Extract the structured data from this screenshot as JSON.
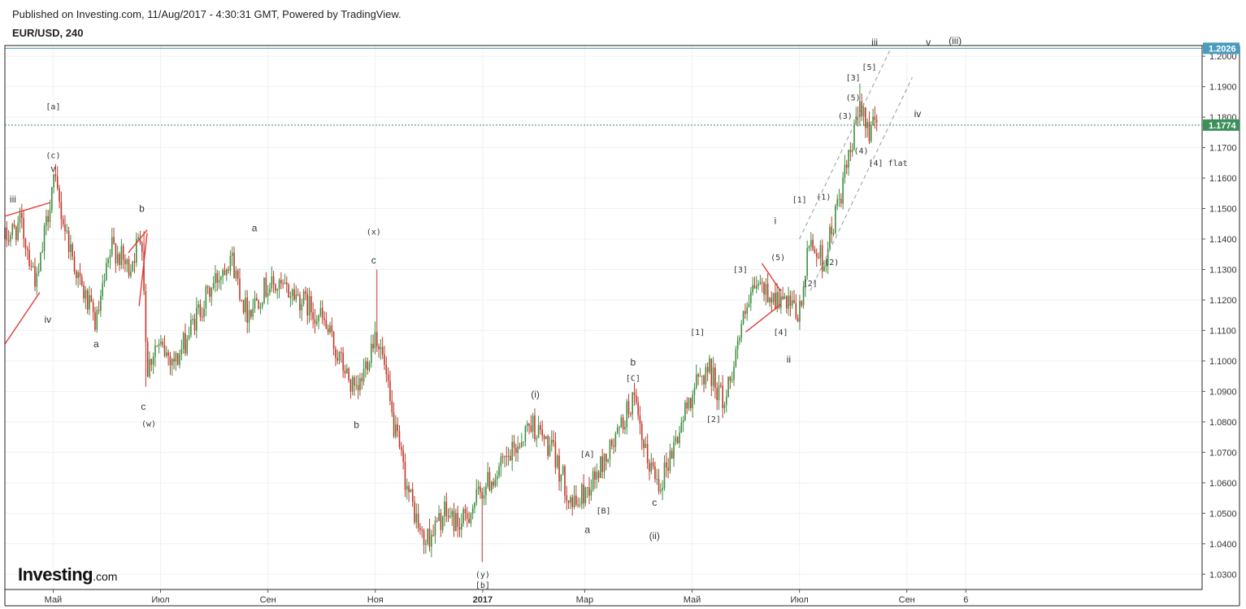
{
  "header": {
    "published": "Published on Investing.com, 11/Aug/2017 - 4:30:31 GMT, Powered by TradingView.",
    "symbol": "EUR/USD, 240"
  },
  "logo": {
    "name": "Investing",
    "suffix": ".com"
  },
  "colors": {
    "up": "#3f8f3f",
    "down": "#c0392b",
    "grid": "#eef0f3",
    "frame": "#222222",
    "hline_top": "#4a9cbf",
    "current_line": "#2e7d4f",
    "current_tag": "#3a8f5a",
    "top_tag": "#4a9cbf",
    "trend_red": "#e53935",
    "channel": "#999999"
  },
  "chart_data": {
    "type": "candlestick",
    "symbol": "EUR/USD",
    "interval": "240",
    "ylim": [
      1.025,
      1.2035
    ],
    "grid": true,
    "y_ticks": [
      1.03,
      1.04,
      1.05,
      1.06,
      1.07,
      1.08,
      1.09,
      1.1,
      1.11,
      1.12,
      1.13,
      1.14,
      1.15,
      1.16,
      1.17,
      1.18,
      1.19,
      1.2
    ],
    "y_tick_labels": [
      "1.0300",
      "1.0400",
      "1.0500",
      "1.0600",
      "1.0700",
      "1.0800",
      "1.0900",
      "1.1000",
      "1.1100",
      "1.1200",
      "1.1300",
      "1.1400",
      "1.1500",
      "1.1600",
      "1.1700",
      "1.1800",
      "1.1900",
      "1.2000"
    ],
    "x_ticks": [
      {
        "label": "Май",
        "t": 0.0,
        "bold": false
      },
      {
        "label": "Июл",
        "t": 2.0,
        "bold": false
      },
      {
        "label": "Сен",
        "t": 4.0,
        "bold": false
      },
      {
        "label": "Ноя",
        "t": 6.0,
        "bold": false
      },
      {
        "label": "2017",
        "t": 8.0,
        "bold": true
      },
      {
        "label": "Мар",
        "t": 9.9,
        "bold": false
      },
      {
        "label": "Май",
        "t": 11.9,
        "bold": false
      },
      {
        "label": "Июл",
        "t": 13.9,
        "bold": false
      },
      {
        "label": "Сен",
        "t": 15.9,
        "bold": false
      },
      {
        "label": "6",
        "t": 17.0,
        "bold": false
      }
    ],
    "x_range": [
      -0.9,
      21.4
    ],
    "horizontal_levels": [
      {
        "value": 1.2026,
        "label": "1.2026",
        "style": "solid",
        "color_key": "top_tag"
      },
      {
        "value": 1.1774,
        "label": "1.1774",
        "style": "dotted",
        "color_key": "current_tag"
      }
    ],
    "price_path": [
      [
        -0.9,
        1.14
      ],
      [
        -0.6,
        1.145
      ],
      [
        -0.3,
        1.125
      ],
      [
        0.0,
        1.16
      ],
      [
        0.2,
        1.145
      ],
      [
        0.5,
        1.125
      ],
      [
        0.8,
        1.112
      ],
      [
        1.1,
        1.138
      ],
      [
        1.4,
        1.13
      ],
      [
        1.65,
        1.142
      ],
      [
        1.75,
        1.097
      ],
      [
        1.9,
        1.105
      ],
      [
        2.3,
        1.1
      ],
      [
        2.7,
        1.116
      ],
      [
        3.3,
        1.135
      ],
      [
        3.6,
        1.116
      ],
      [
        4.0,
        1.125
      ],
      [
        4.5,
        1.122
      ],
      [
        5.0,
        1.114
      ],
      [
        5.3,
        1.102
      ],
      [
        5.65,
        1.088
      ],
      [
        6.0,
        1.11
      ],
      [
        6.15,
        1.1
      ],
      [
        6.3,
        1.082
      ],
      [
        6.6,
        1.058
      ],
      [
        6.9,
        1.04
      ],
      [
        7.3,
        1.05
      ],
      [
        7.6,
        1.046
      ],
      [
        8.0,
        1.058
      ],
      [
        8.5,
        1.068
      ],
      [
        8.9,
        1.08
      ],
      [
        9.3,
        1.07
      ],
      [
        9.7,
        1.052
      ],
      [
        10.1,
        1.062
      ],
      [
        10.5,
        1.075
      ],
      [
        10.8,
        1.088
      ],
      [
        11.0,
        1.07
      ],
      [
        11.3,
        1.06
      ],
      [
        11.6,
        1.074
      ],
      [
        11.9,
        1.09
      ],
      [
        12.2,
        1.098
      ],
      [
        12.5,
        1.086
      ],
      [
        12.8,
        1.11
      ],
      [
        13.1,
        1.125
      ],
      [
        13.5,
        1.12
      ],
      [
        13.9,
        1.115
      ],
      [
        14.1,
        1.14
      ],
      [
        14.35,
        1.132
      ],
      [
        14.6,
        1.15
      ],
      [
        14.85,
        1.168
      ],
      [
        15.05,
        1.185
      ],
      [
        15.2,
        1.176
      ],
      [
        15.35,
        1.177
      ]
    ],
    "path_spikes": [
      {
        "t": 0.02,
        "high": 1.1615
      },
      {
        "t": 1.68,
        "high": 1.1425
      },
      {
        "t": 1.72,
        "low": 1.0915
      },
      {
        "t": 6.02,
        "high": 1.13
      },
      {
        "t": 7.98,
        "low": 1.034
      },
      {
        "t": 15.02,
        "high": 1.191
      }
    ],
    "wave_labels": [
      {
        "text": "[a]",
        "t": 0.0,
        "y": 1.1825,
        "size": "small"
      },
      {
        "text": "(c)",
        "t": 0.0,
        "y": 1.1665,
        "size": "small"
      },
      {
        "text": "v",
        "t": 0.0,
        "y": 1.162,
        "size": "normal"
      },
      {
        "text": "iii",
        "t": -0.75,
        "y": 1.152,
        "size": "normal"
      },
      {
        "text": "iv",
        "t": -0.1,
        "y": 1.1125,
        "size": "normal"
      },
      {
        "text": "a",
        "t": 0.8,
        "y": 1.1045,
        "size": "normal"
      },
      {
        "text": "b",
        "t": 1.65,
        "y": 1.149,
        "size": "normal"
      },
      {
        "text": "c",
        "t": 1.68,
        "y": 1.084,
        "size": "normal"
      },
      {
        "text": "(w)",
        "t": 1.78,
        "y": 1.0785,
        "size": "small"
      },
      {
        "text": "a",
        "t": 3.75,
        "y": 1.1425,
        "size": "normal"
      },
      {
        "text": "(x)",
        "t": 5.97,
        "y": 1.1415,
        "size": "small"
      },
      {
        "text": "c",
        "t": 5.97,
        "y": 1.132,
        "size": "normal"
      },
      {
        "text": "b",
        "t": 5.65,
        "y": 1.078,
        "size": "normal"
      },
      {
        "text": "(y)",
        "t": 8.0,
        "y": 1.029,
        "size": "small"
      },
      {
        "text": "[b]",
        "t": 8.0,
        "y": 1.0255,
        "size": "small"
      },
      {
        "text": "(i)",
        "t": 8.98,
        "y": 1.088,
        "size": "normal"
      },
      {
        "text": "[A]",
        "t": 9.95,
        "y": 1.0685,
        "size": "small"
      },
      {
        "text": "[B]",
        "t": 10.25,
        "y": 1.05,
        "size": "small"
      },
      {
        "text": "a",
        "t": 9.95,
        "y": 1.0435,
        "size": "normal"
      },
      {
        "text": "b",
        "t": 10.8,
        "y": 1.0985,
        "size": "normal"
      },
      {
        "text": "[C]",
        "t": 10.8,
        "y": 1.0935,
        "size": "small"
      },
      {
        "text": "c",
        "t": 11.2,
        "y": 1.0525,
        "size": "normal"
      },
      {
        "text": "(ii)",
        "t": 11.2,
        "y": 1.0415,
        "size": "normal"
      },
      {
        "text": "[1]",
        "t": 12.0,
        "y": 1.1085,
        "size": "small"
      },
      {
        "text": "[2]",
        "t": 12.3,
        "y": 1.08,
        "size": "small"
      },
      {
        "text": "[3]",
        "t": 12.8,
        "y": 1.129,
        "size": "small"
      },
      {
        "text": "i",
        "t": 13.45,
        "y": 1.145,
        "size": "normal"
      },
      {
        "text": "(5)",
        "t": 13.5,
        "y": 1.133,
        "size": "small"
      },
      {
        "text": "[4]",
        "t": 13.55,
        "y": 1.1085,
        "size": "small"
      },
      {
        "text": "ii",
        "t": 13.7,
        "y": 1.0995,
        "size": "normal"
      },
      {
        "text": "[1]",
        "t": 13.9,
        "y": 1.152,
        "size": "small"
      },
      {
        "text": "(1)",
        "t": 14.35,
        "y": 1.153,
        "size": "small"
      },
      {
        "text": "[2]",
        "t": 14.1,
        "y": 1.1245,
        "size": "small"
      },
      {
        "text": "(2)",
        "t": 14.5,
        "y": 1.1315,
        "size": "small"
      },
      {
        "text": "(3)",
        "t": 14.75,
        "y": 1.1795,
        "size": "small"
      },
      {
        "text": "(5)",
        "t": 14.9,
        "y": 1.1855,
        "size": "small"
      },
      {
        "text": "[3]",
        "t": 14.9,
        "y": 1.192,
        "size": "small"
      },
      {
        "text": "(4)",
        "t": 15.05,
        "y": 1.168,
        "size": "small"
      },
      {
        "text": "[5]",
        "t": 15.2,
        "y": 1.1955,
        "size": "small"
      },
      {
        "text": "[4] flat",
        "t": 15.55,
        "y": 1.164,
        "size": "small"
      },
      {
        "text": "iii",
        "t": 15.3,
        "y": 1.2035,
        "size": "normal"
      },
      {
        "text": "v",
        "t": 16.3,
        "y": 1.2035,
        "size": "normal"
      },
      {
        "text": "(iii)",
        "t": 16.8,
        "y": 1.204,
        "size": "normal"
      },
      {
        "text": "iv",
        "t": 16.1,
        "y": 1.18,
        "size": "normal"
      }
    ],
    "trend_lines": [
      {
        "t1": -0.9,
        "y1": 1.1055,
        "t2": -0.25,
        "y2": 1.1225,
        "color_key": "trend_red",
        "dash": false
      },
      {
        "t1": -0.9,
        "y1": 1.1475,
        "t2": -0.05,
        "y2": 1.152,
        "color_key": "trend_red",
        "dash": false
      },
      {
        "t1": 1.4,
        "y1": 1.1355,
        "t2": 1.75,
        "y2": 1.143,
        "color_key": "trend_red",
        "dash": false
      },
      {
        "t1": 1.6,
        "y1": 1.118,
        "t2": 1.75,
        "y2": 1.142,
        "color_key": "trend_red",
        "dash": false
      },
      {
        "t1": 12.9,
        "y1": 1.1095,
        "t2": 13.55,
        "y2": 1.1185,
        "color_key": "trend_red",
        "dash": false
      },
      {
        "t1": 13.2,
        "y1": 1.132,
        "t2": 13.55,
        "y2": 1.123,
        "color_key": "trend_red",
        "dash": false
      },
      {
        "t1": 13.9,
        "y1": 1.14,
        "t2": 15.6,
        "y2": 1.2025,
        "color_key": "channel",
        "dash": true
      },
      {
        "t1": 14.1,
        "y1": 1.123,
        "t2": 16.0,
        "y2": 1.193,
        "color_key": "channel",
        "dash": true
      }
    ]
  }
}
